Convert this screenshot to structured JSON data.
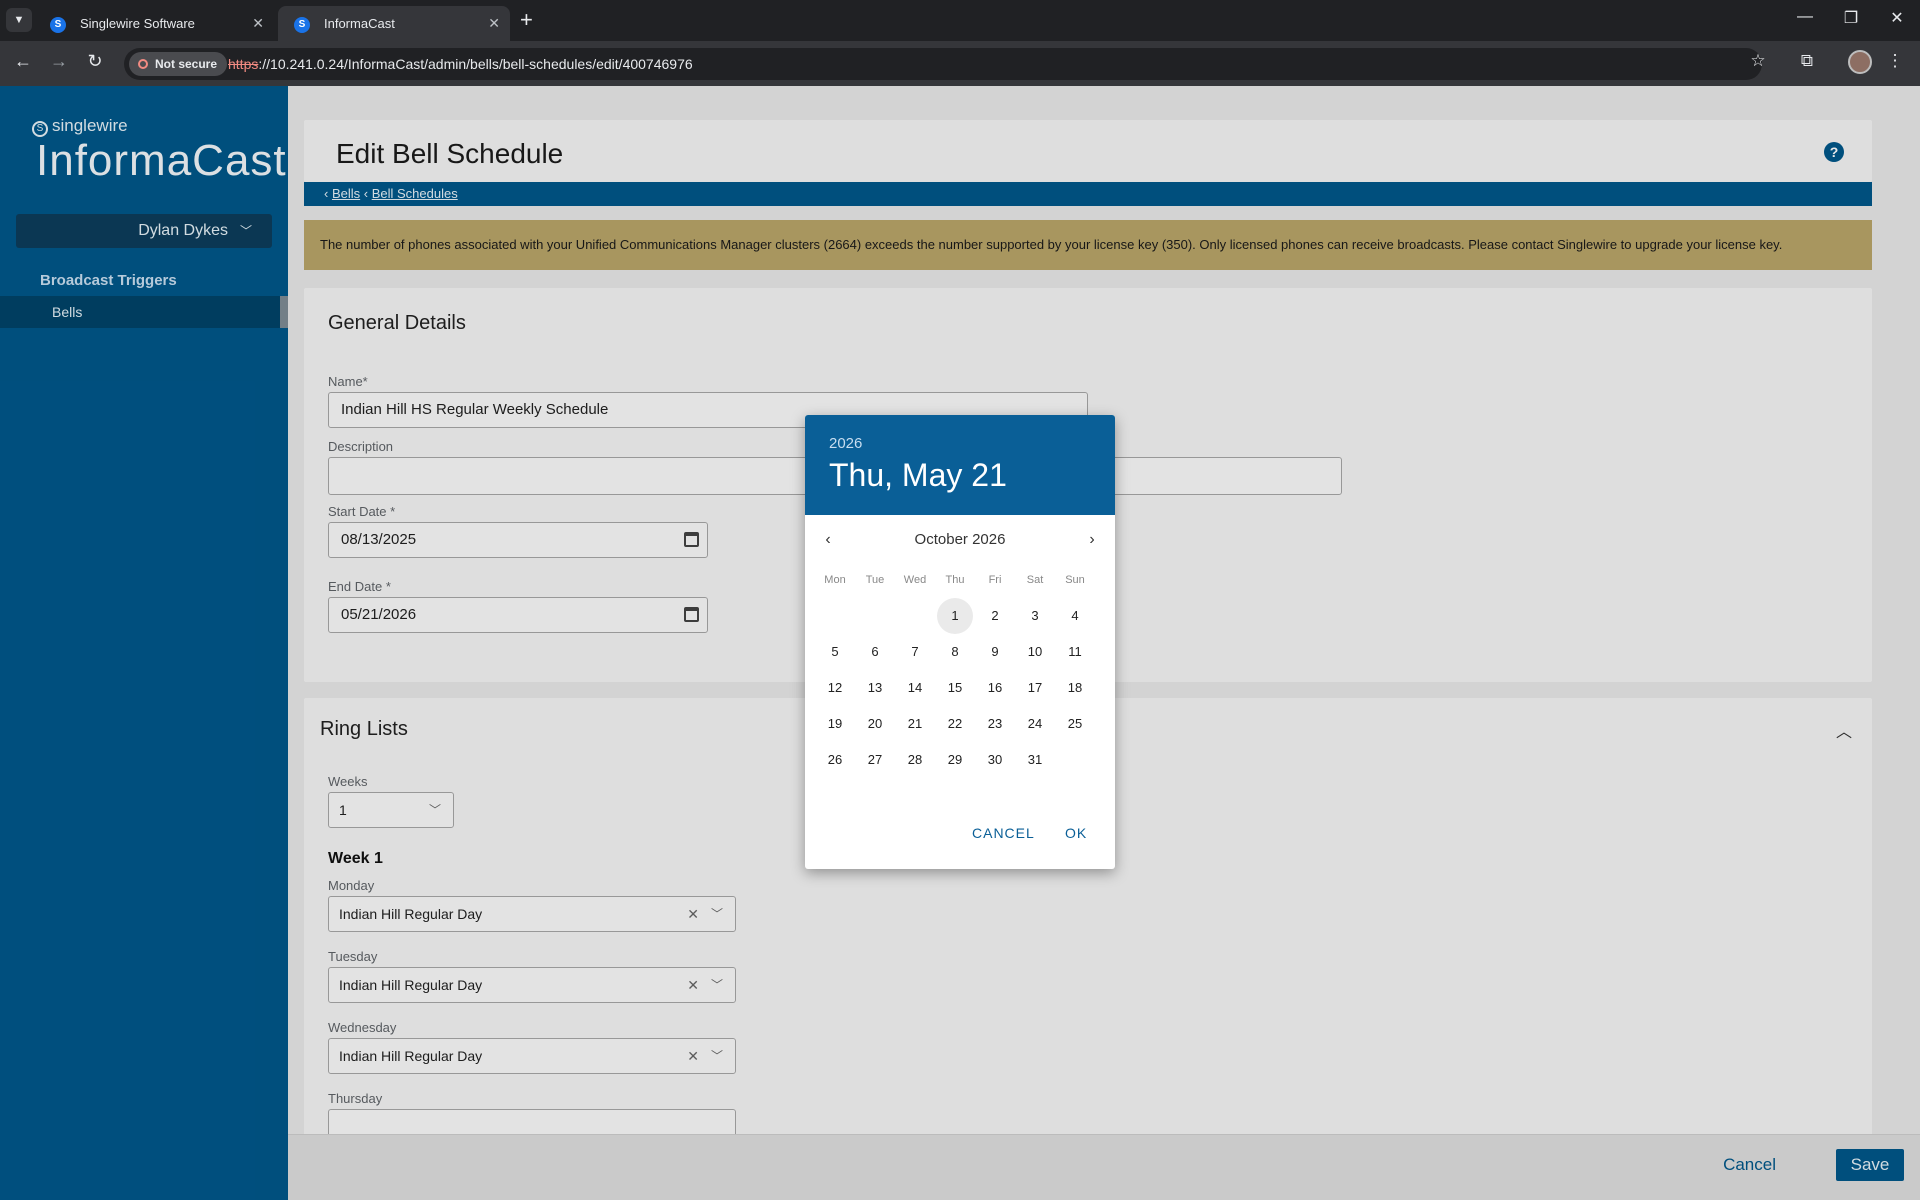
{
  "browser": {
    "tabs": [
      {
        "title": "Singlewire Software",
        "icon": "singlewire-icon"
      },
      {
        "title": "InformaCast",
        "icon": "singlewire-icon"
      }
    ],
    "not_secure": "Not secure",
    "url_scheme": "https",
    "url_rest": "://10.241.0.24/InformaCast/admin/bells/bell-schedules/edit/400746976"
  },
  "sidebar": {
    "brand_small": "singlewire",
    "brand_large": "InformaCast",
    "user": "Dylan Dykes",
    "section": "Broadcast Triggers",
    "items": [
      {
        "label": "Bells"
      }
    ]
  },
  "page": {
    "title": "Edit Bell Schedule",
    "breadcrumbs": [
      {
        "label": "Bells"
      },
      {
        "label": "Bell Schedules"
      }
    ],
    "warning": "The number of phones associated with your Unified Communications Manager clusters (2664) exceeds the number supported by your license key (350). Only licensed phones can receive broadcasts. Please contact Singlewire to upgrade your license key."
  },
  "general": {
    "heading": "General Details",
    "name_label": "Name*",
    "name_value": "Indian Hill HS Regular Weekly Schedule",
    "description_label": "Description",
    "description_value": "",
    "start_label": "Start Date *",
    "start_value": "08/13/2025",
    "end_label": "End Date *",
    "end_value": "05/21/2026"
  },
  "ring_lists": {
    "heading": "Ring Lists",
    "weeks_label": "Weeks",
    "weeks_value": "1",
    "week_title": "Week 1",
    "days": [
      {
        "label": "Monday",
        "value": "Indian Hill Regular Day"
      },
      {
        "label": "Tuesday",
        "value": "Indian Hill Regular Day"
      },
      {
        "label": "Wednesday",
        "value": "Indian Hill Regular Day"
      },
      {
        "label": "Thursday",
        "value": ""
      }
    ]
  },
  "footer": {
    "cancel": "Cancel",
    "save": "Save"
  },
  "datepicker": {
    "year": "2026",
    "selected_date": "Thu, May 21",
    "month_label": "October 2026",
    "weekdays": [
      "Mon",
      "Tue",
      "Wed",
      "Thu",
      "Fri",
      "Sat",
      "Sun"
    ],
    "first_weekday_index": 3,
    "days_in_month": 31,
    "today": 1,
    "cancel": "CANCEL",
    "ok": "OK"
  },
  "colors": {
    "brand": "#00578a",
    "warning": "#b9a569",
    "picker_header": "#0a5f97"
  }
}
